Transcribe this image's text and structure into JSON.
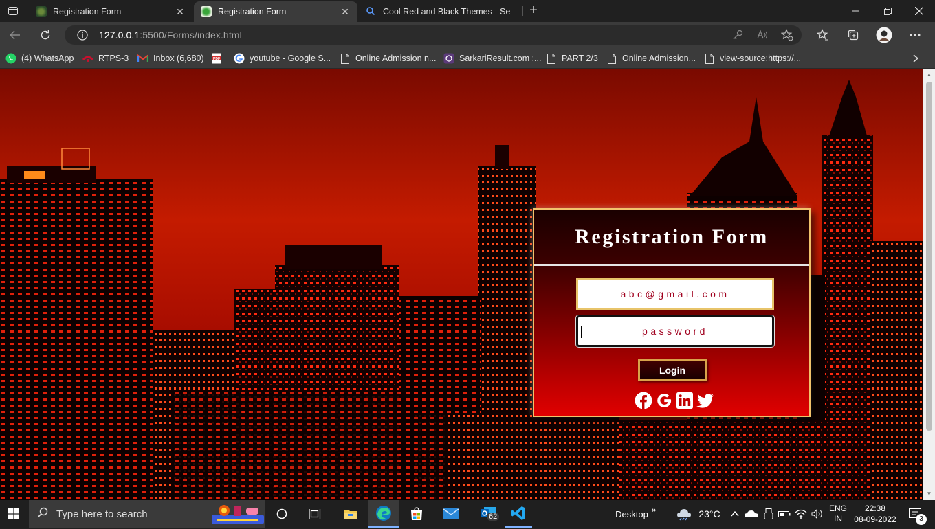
{
  "browser": {
    "tabs": [
      {
        "title": "Registration Form",
        "active": false
      },
      {
        "title": "Registration Form",
        "active": true
      },
      {
        "title": "Cool Red and Black Themes - Se",
        "active": false
      }
    ],
    "url": {
      "host": "127.0.0.1",
      "path": ":5500/Forms/index.html"
    },
    "bookmarks": [
      {
        "label": "(4) WhatsApp",
        "icon": "whatsapp-icon"
      },
      {
        "label": "RTPS-3",
        "icon": "rtps-icon"
      },
      {
        "label": "Inbox (6,680)",
        "icon": "gmail-icon"
      },
      {
        "label": "",
        "icon": "pdf-icon"
      },
      {
        "label": "youtube - Google S...",
        "icon": "google-icon"
      },
      {
        "label": "Online Admission n...",
        "icon": "page-icon"
      },
      {
        "label": "SarkariResult.com :...",
        "icon": "sarkari-icon"
      },
      {
        "label": "PART 2/3",
        "icon": "page-icon"
      },
      {
        "label": "Online Admission...",
        "icon": "page-icon"
      },
      {
        "label": "view-source:https://...",
        "icon": "page-icon"
      }
    ]
  },
  "form": {
    "title": "Registration Form",
    "email_placeholder": "abc@gmail.com",
    "password_placeholder": "password",
    "login_label": "Login",
    "social_icons": [
      "facebook-icon",
      "google-icon",
      "linkedin-icon",
      "twitter-icon"
    ]
  },
  "taskbar": {
    "search_placeholder": "Type here to search",
    "desktop_label": "Desktop",
    "temperature": "23°C",
    "language_top": "ENG",
    "language_bottom": "IN",
    "time": "22:38",
    "date": "08-09-2022",
    "mail_badge": "62",
    "notification_count": "3"
  },
  "colors": {
    "accent_red": "#cc0000",
    "gold_border": "#f2c26b"
  }
}
